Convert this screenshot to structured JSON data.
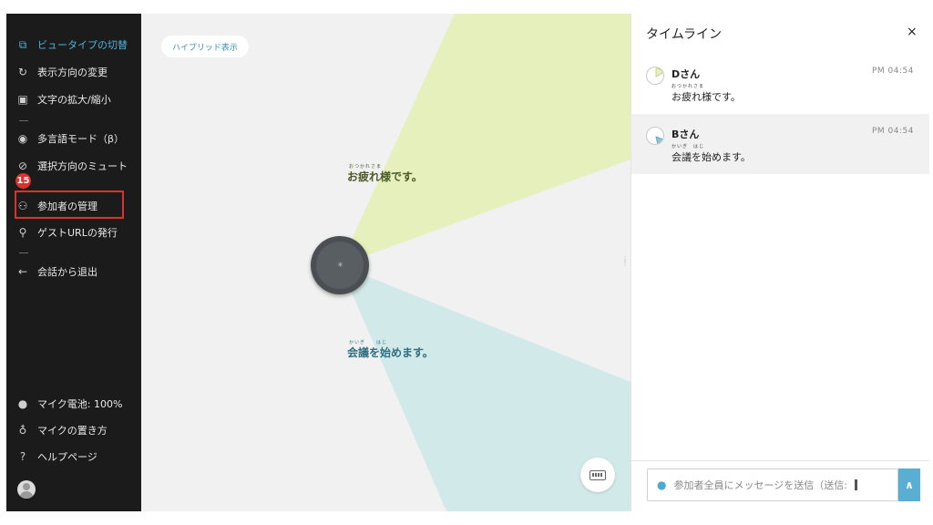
{
  "sidebar": {
    "items": [
      {
        "label": "ビュータイプの切替",
        "icon": "view-switch-icon"
      },
      {
        "label": "表示方向の変更",
        "icon": "rotate-icon"
      },
      {
        "label": "文字の拡大/縮小",
        "icon": "text-size-icon"
      },
      {
        "label": "多言語モード（β）",
        "icon": "translate-icon"
      },
      {
        "label": "選択方向のミュート",
        "icon": "mute-direction-icon"
      },
      {
        "label": "参加者の管理",
        "icon": "participants-icon"
      },
      {
        "label": "ゲストURLの発行",
        "icon": "link-icon"
      },
      {
        "label": "会話から退出",
        "icon": "exit-arrow-icon"
      }
    ],
    "step_badge": "15",
    "status": [
      {
        "label": "マイク電池: 100%",
        "icon": "battery-icon"
      },
      {
        "label": "マイクの置き方",
        "icon": "mic-icon"
      },
      {
        "label": "ヘルプページ",
        "icon": "help-icon"
      }
    ]
  },
  "main": {
    "hybrid_label": "ハイブリッド表示",
    "caption_d": "お疲れ様です。",
    "caption_d_ruby": "おつかれさま",
    "caption_b": "会議を始めます。",
    "caption_b_ruby": "かいぎ　　はじ",
    "colors": {
      "d_sector": "#e6f0bd",
      "b_sector": "#d2e9ea",
      "background": "#f1f1f1"
    }
  },
  "timeline": {
    "title": "タイムライン",
    "close": "×",
    "messages": [
      {
        "name": "Dさん",
        "time": "PM 04:54",
        "text": "お疲れ様です。",
        "ruby": "おつかれさま"
      },
      {
        "name": "Bさん",
        "time": "PM 04:54",
        "text": "会議を始めます。",
        "ruby": "かいぎ　はじ"
      }
    ],
    "input_placeholder": "参加者全員にメッセージを送信（送信:",
    "send_icon": "send-icon"
  }
}
